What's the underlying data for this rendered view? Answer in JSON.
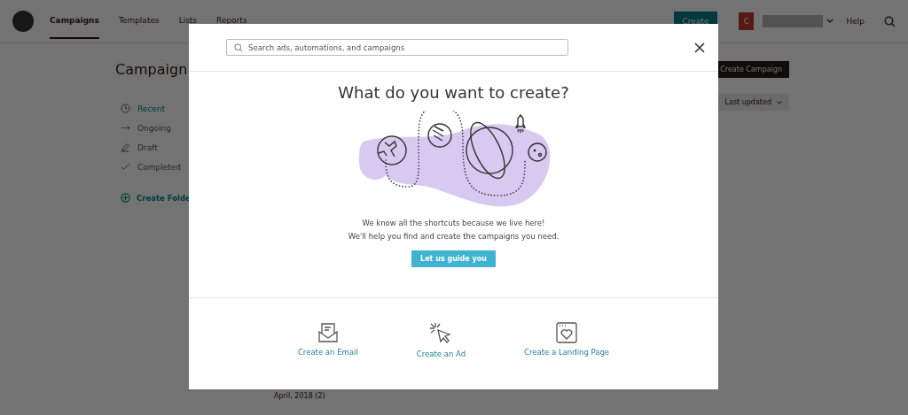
{
  "nav": {
    "items": [
      {
        "label": "Campaigns",
        "selected": true
      },
      {
        "label": "Templates",
        "selected": false
      },
      {
        "label": "Lists",
        "selected": false
      },
      {
        "label": "Reports",
        "selected": false
      }
    ],
    "create_button": "Create",
    "avatar": "C",
    "help": "Help"
  },
  "page": {
    "title": "Campaign",
    "create_button": "Create Campaign",
    "sidebar": [
      {
        "label": "Recent",
        "selected": true
      },
      {
        "label": "Ongoing",
        "selected": false
      },
      {
        "label": "Draft",
        "selected": false
      },
      {
        "label": "Completed",
        "selected": false
      }
    ],
    "create_folder": "Create Folde",
    "sort": "Last updated",
    "group": "April, 2018 (2)"
  },
  "modal": {
    "search": {
      "placeholder": "Search ads, automations, and campaigns"
    },
    "title": "What do you want to create?",
    "lines": [
      "We know all the shortcuts because we live here!",
      "We'll help you find and create the campaigns you need."
    ],
    "guide_button": "Let us guide you",
    "options": [
      {
        "kind": "email",
        "label": "Create an Email"
      },
      {
        "kind": "ad",
        "label": "Create an Ad"
      },
      {
        "kind": "landing",
        "label": "Create a Landing Page"
      }
    ]
  }
}
